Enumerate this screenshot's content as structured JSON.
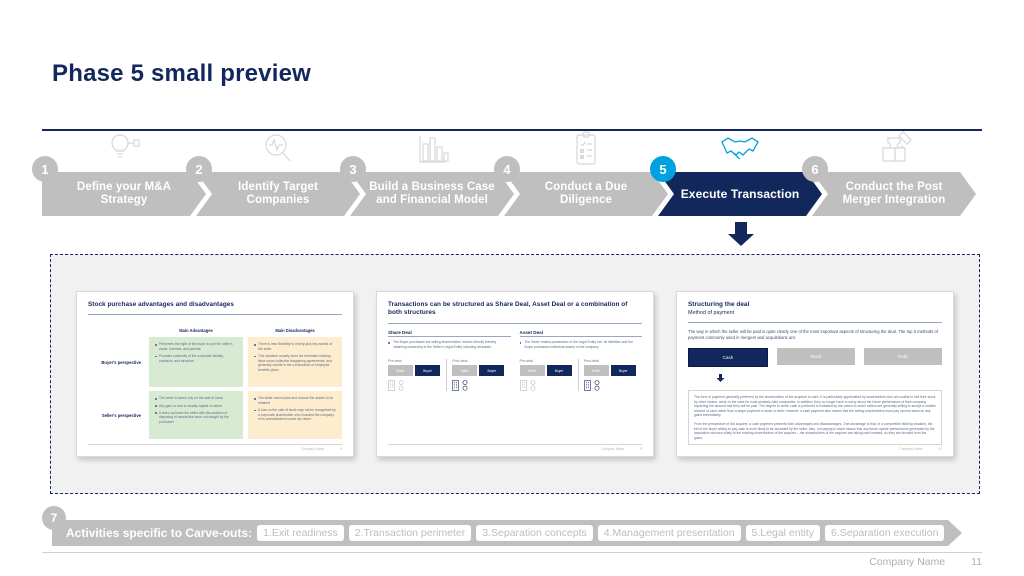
{
  "page_title": "Phase 5 small preview",
  "colors": {
    "navy": "#12275c",
    "cyan": "#00a1e0",
    "gray": "#bfbfbf",
    "panel_bg": "#f1f1f1",
    "green_cell": "#d9ead3",
    "amber_cell": "#fdeccd"
  },
  "process": {
    "steps": [
      {
        "number": "1",
        "label": "Define your M&A Strategy",
        "icon": "lightbulb-icon",
        "active": false
      },
      {
        "number": "2",
        "label": "Identify Target Companies",
        "icon": "magnifier-pulse-icon",
        "active": false
      },
      {
        "number": "3",
        "label": "Build a Business Case and Financial Model",
        "icon": "bar-chart-icon",
        "active": false
      },
      {
        "number": "4",
        "label": "Conduct a Due Diligence",
        "icon": "clipboard-checklist-icon",
        "active": false
      },
      {
        "number": "5",
        "label": "Execute Transaction",
        "icon": "handshake-icon",
        "active": true
      },
      {
        "number": "6",
        "label": "Conduct the Post Merger Integration",
        "icon": "puzzle-icon",
        "active": false
      }
    ]
  },
  "previews": [
    {
      "title": "Stock purchase advantages and disadvantages",
      "column_headers": [
        "Main Advantages",
        "Main Disadvantages"
      ],
      "row_headers": [
        "Buyer's perspective",
        "Seller's perspective"
      ],
      "cells": {
        "buyer_advantages": [
          "Preserves the right of the buyer to use the seller's name, licenses, and permits",
          "Provides continuity of the corporate identity, contracts, and structure"
        ],
        "buyer_disadvantages": [
          "There is less flexibility to cherry-pick key assets of the seller",
          "This structure usually does not terminate existing labor union collective bargaining agreements, and generally results in the continuation of employee benefits plans"
        ],
        "seller_advantages": [
          "The seller is taxed only on the sale of stock",
          "Any gain or loss is usually capital in nature",
          "It does not leave the seller with the problem of disposing of assets that were not bought by the purchaser"
        ],
        "seller_disadvantages": [
          "The seller cannot pick and choose the assets to be retained",
          "A loss on the sale of stock may not be recognized by a corporate shareholder who included the company in its consolidated income tax return"
        ]
      },
      "footer_company": "Company Name",
      "footer_page": "9"
    },
    {
      "title": "Transactions can be structured as Share Deal, Asset Deal or a combination of both structures",
      "columns": [
        {
          "head": "Share Deal",
          "bullet": "The Buyer purchases the selling shareholders' shares directly thereby obtaining ownership in the Seller's Legal Entity including all assets",
          "phases": [
            {
              "label": "Pre-deal",
              "boxes": [
                "Seller",
                "Buyer"
              ]
            },
            {
              "label": "Post-deal",
              "boxes": [
                "Seller",
                "Buyer"
              ]
            }
          ]
        },
        {
          "head": "Asset Deal",
          "bullet": "The Seller retains possession of the Legal Entity incl. its liabilities and the Buyer purchases individual assets of the company",
          "phases": [
            {
              "label": "Pre-deal",
              "boxes": [
                "Seller",
                "Buyer"
              ]
            },
            {
              "label": "Post-deal",
              "boxes": [
                "Seller",
                "Buyer"
              ]
            }
          ]
        }
      ],
      "footer_company": "Company Name",
      "footer_page": "9"
    },
    {
      "title": "Structuring the deal",
      "subtitle": "Method of payment",
      "intro": "The way in which the seller will be paid is quite clearly one of the most important aspects of structuring the deal. The top 3 methods of payment commonly used in mergers and acquisitions are:",
      "payment_options": [
        "Cash",
        "Stock",
        "Debt"
      ],
      "selected_payment": "Cash",
      "body_paragraphs": [
        "The form of payment generally preferred by the shareholders of the acquiree is cash. It is particularly appreciated by shareholders who are unable to sell their stock by other means, which is the case for most privately-held companies. In addition, they no longer have to worry about the future performance of their company impacting the amount that they will be paid. The degree to which cash is preferred is indicated by the extent to which sellers are generally willing to accept a smaller amount of cash rather than a larger payment in stock or debt. However, a cash payment also means that the selling shareholders must pay income taxes on any gains immediately.",
        "From the perspective of the acquirer, a cash payment presents both advantages and disadvantages. One advantage is that, in a competitive bidding situation, the bid of the buyer willing to pay cash is more likely to be accepted by the seller. Also, not paying in stock means that any future upside performance generated by the acquisition accrues solely to the existing shareholders of the acquirer – the shareholders of the acquirer are taking cash instead, so they are blocked from the gains."
      ],
      "footer_company": "Company Name",
      "footer_page": "10"
    }
  ],
  "carve_outs": {
    "number": "7",
    "title": "Activities specific to Carve-outs:",
    "items": [
      "1.Exit readiness",
      "2.Transaction perimeter",
      "3.Separation concepts",
      "4.Management presentation",
      "5.Legal entity",
      "6.Separation execution"
    ]
  },
  "footer": {
    "company": "Company Name",
    "page": "11"
  }
}
